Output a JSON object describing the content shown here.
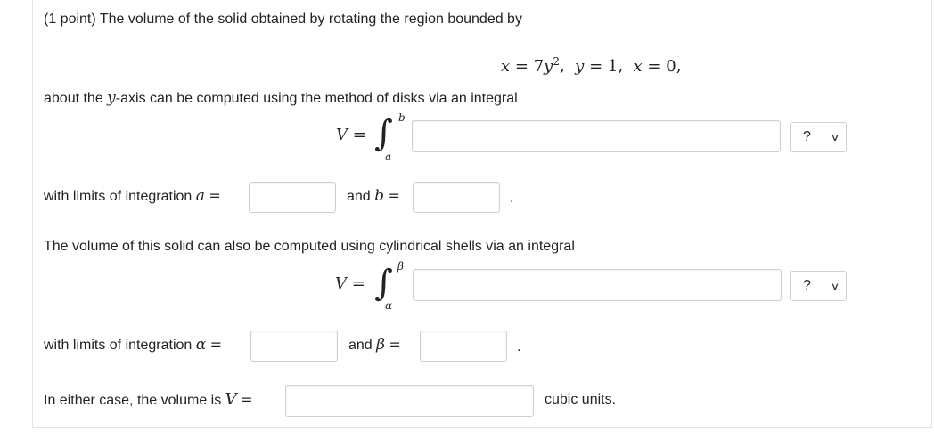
{
  "problem": {
    "intro": "(1 point) The volume of the solid obtained by rotating the region bounded by",
    "equation": {
      "x_var": "x",
      "eq": "=",
      "coef": "7",
      "y_var": "y",
      "exp": "2",
      "y1_var": "y",
      "y1_val": "1",
      "x0_var": "x",
      "x0_val": "0"
    },
    "about_prefix": "about the ",
    "axis_var": "y",
    "about_suffix": "-axis can be computed using the method of disks via an integral"
  },
  "disks": {
    "V": "V",
    "eq": "=",
    "upper": "b",
    "lower": "a",
    "integrand_value": "",
    "select_value": "?",
    "limits_text": "with limits of integration ",
    "a_var": "a",
    "and_text": "and ",
    "b_var": "b",
    "a_value": "",
    "b_value": "",
    "period": "."
  },
  "shells": {
    "intro": "The volume of this solid can also be computed using cylindrical shells via an integral",
    "V": "V",
    "eq": "=",
    "upper": "β",
    "lower": "α",
    "integrand_value": "",
    "select_value": "?",
    "limits_text": "with limits of integration ",
    "alpha_var": "α",
    "and_text": "and ",
    "beta_var": "β",
    "alpha_value": "",
    "beta_value": "",
    "period": "."
  },
  "volume": {
    "prefix": "In either case, the volume is ",
    "V": "V",
    "eq": "=",
    "value": "",
    "units": "cubic units."
  }
}
